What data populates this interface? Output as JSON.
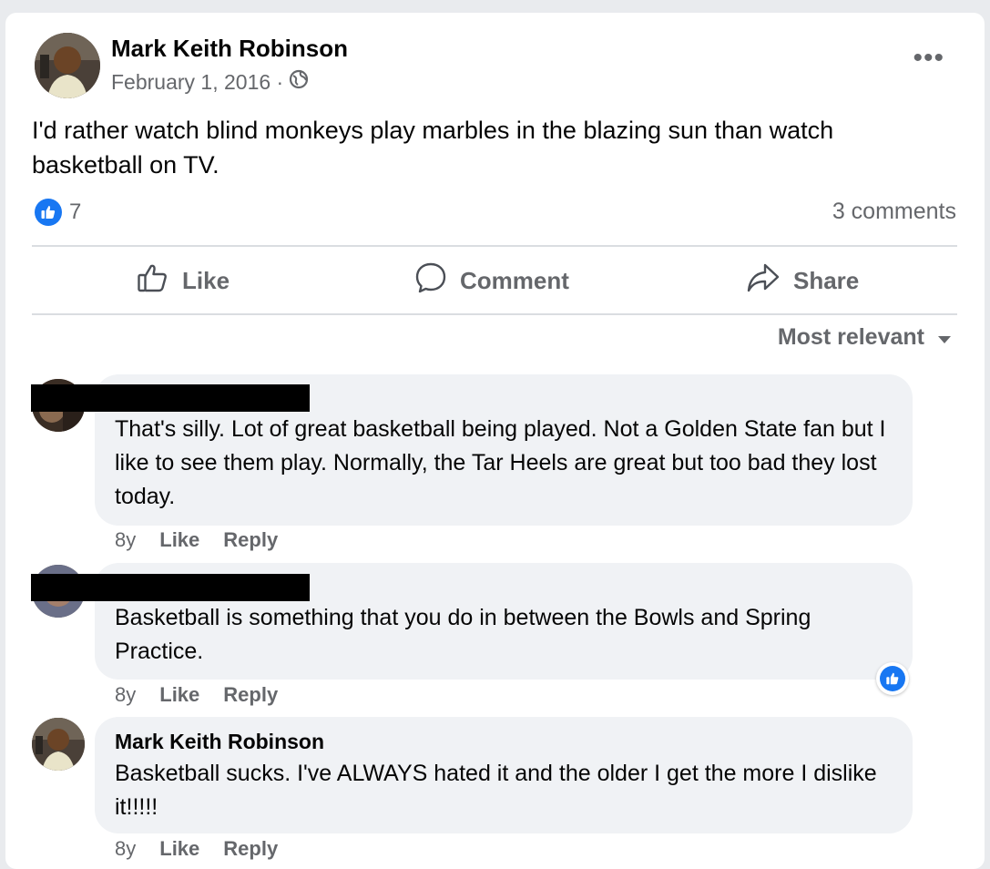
{
  "post": {
    "author": "Mark Keith Robinson",
    "date": "February 1, 2016 ·",
    "text": "I'd rather watch blind monkeys play marbles in the blazing sun than watch basketball on TV.",
    "reaction_count": "7",
    "comments_count": "3 comments",
    "more_label": "•••"
  },
  "actions": {
    "like": "Like",
    "comment": "Comment",
    "share": "Share"
  },
  "sort_label": "Most relevant",
  "comments": [
    {
      "text": "That's silly. Lot of great basketball being played. Not a Golden State fan but I like to see them play. Normally, the Tar Heels are great but too bad they lost today.",
      "age": "8y",
      "like": "Like",
      "reply": "Reply"
    },
    {
      "text": "Basketball is something that you do in between the Bowls and Spring Practice.",
      "age": "8y",
      "like": "Like",
      "reply": "Reply"
    },
    {
      "author": "Mark Keith Robinson",
      "text": "Basketball sucks. I've ALWAYS hated it and the older I get the more I dislike it!!!!!",
      "age": "8y",
      "like": "Like",
      "reply": "Reply"
    }
  ],
  "icons": {
    "privacy": "globe-icon",
    "reaction": "thumbs-up-icon",
    "sort": "caret-down-icon"
  },
  "colors": {
    "accent": "#1877f2",
    "muted_text": "#65676b",
    "bubble_bg": "#f0f2f5"
  }
}
